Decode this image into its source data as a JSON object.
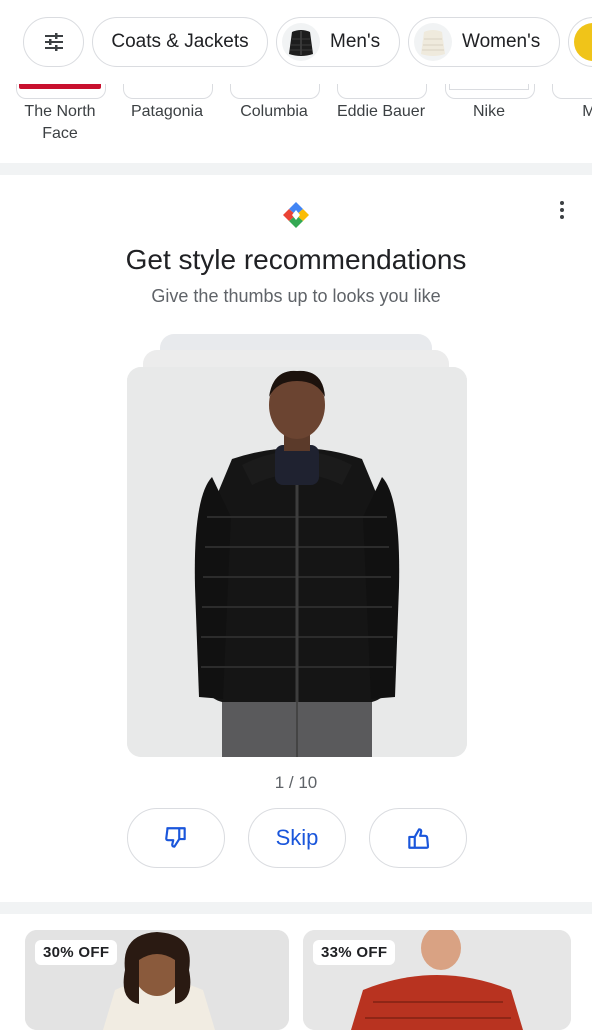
{
  "filters": {
    "chips": [
      {
        "label": "Coats & Jackets"
      },
      {
        "label": "Men's",
        "thumb": "black-puffer-jacket"
      },
      {
        "label": "Women's",
        "thumb": "cream-puffer-jacket"
      },
      {
        "label": "",
        "thumb": "yellow-jacket"
      }
    ]
  },
  "brands": [
    {
      "label": "The North Face"
    },
    {
      "label": "Patagonia"
    },
    {
      "label": "Columbia"
    },
    {
      "label": "Eddie Bauer"
    },
    {
      "label": "Nike"
    },
    {
      "label": "Mor"
    }
  ],
  "recommend": {
    "title": "Get style recommendations",
    "subtitle": "Give the thumbs up to looks you like",
    "counter": "1 / 10",
    "skip_label": "Skip",
    "colors": {
      "accent": "#1a56db"
    }
  },
  "products": [
    {
      "badge": "30% OFF"
    },
    {
      "badge": "33% OFF"
    }
  ]
}
